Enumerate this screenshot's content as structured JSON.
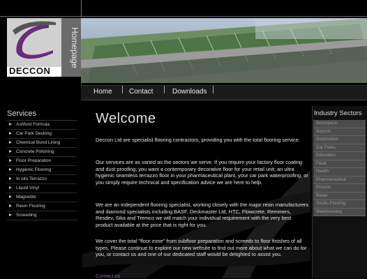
{
  "brand": {
    "logo_text": "DECCON",
    "homepage_label": "Homepage"
  },
  "nav": {
    "items": [
      "Home",
      "Contact",
      "Downloads"
    ]
  },
  "services": {
    "title": "Services",
    "items": [
      "Ashford Formula",
      "Car Park Decking",
      "Chemical Bund Lining",
      "Concrete Polishing",
      "Floor Preparation",
      "Hygienic Flooring",
      "In situ Terrazzo",
      "Liquid Vinyl",
      "Magnetite",
      "Resin Flooring",
      "Screeding"
    ]
  },
  "main": {
    "heading": "Welcome",
    "paragraphs": [
      "Deccon Ltd are specialist flooring contractors, providing you with the total flooring service.",
      "Our services are as varied as the sectors we serve. If you require your factory floor coating and dust proofing; you want a contemporary decorative floor for your retail unit; an ultra hygienic seamless terrazzo floor in your pharmaceutical plant, your car park waterproofing, or you simply require technical and specification advice we are here to help.",
      "We are an independent flooring specialist, working closely with the major resin manufacturers and diamond specialists including BASF, Deckmaster Ltd, HTC, Flowcrete, Remmers, Resdev, Sika and Tremco we will match your individual requirement with the very best product available at the price that is right for you.",
      "We cover the total \"floor zone\" from subfloor preparation and screeds to floor finishes of all types. Please continue to explore our new website to find out more about what we can do for you, or contact us and one of our dedicated staff would be delighted to assist you."
    ],
    "contact_link": "Contact us"
  },
  "industry": {
    "title": "Industry Sectors",
    "items": [
      "Aerospace",
      "Airports",
      "Automotive",
      "Car Parks",
      "Education",
      "Food",
      "Health",
      "Pharmaceutical",
      "Prisons",
      "Retail",
      "Studio Flooring",
      "Warehousing"
    ]
  },
  "colors": {
    "background": "#000000",
    "link": "#a050c0",
    "sector_bg": "#4c4c4c"
  }
}
